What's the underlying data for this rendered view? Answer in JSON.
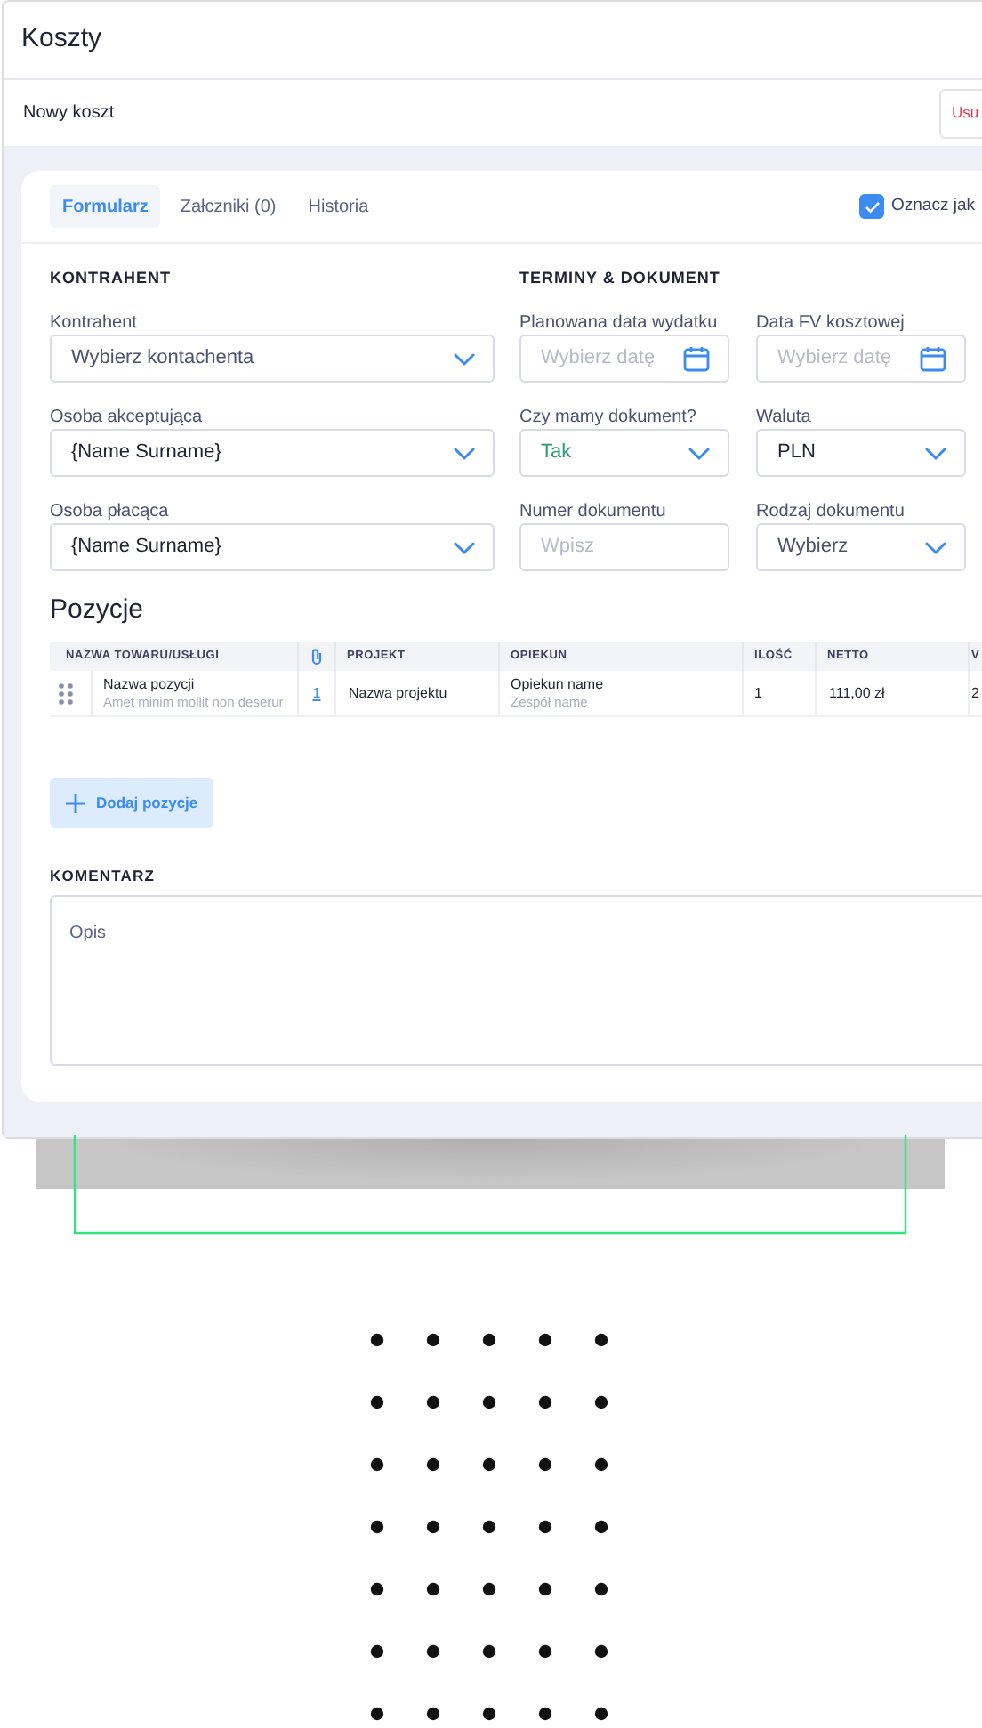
{
  "page": {
    "title": "Koszty"
  },
  "toolbar": {
    "title": "Nowy koszt",
    "delete_button": "Usu"
  },
  "tabs": [
    {
      "label": "Formularz",
      "selected": true
    },
    {
      "label": "Załczniki (0)",
      "selected": false
    },
    {
      "label": "Historia",
      "selected": false
    }
  ],
  "mark_checkbox": {
    "label": "Oznacz jak",
    "checked": true
  },
  "contractor": {
    "heading": "KONTRAHENT",
    "fields": [
      {
        "label": "Kontrahent",
        "kind": "select",
        "placeholder": "Wybierz kontachenta"
      },
      {
        "label": "Osoba akceptująca",
        "kind": "select",
        "value": "{Name Surname}"
      },
      {
        "label": "Osoba płacąca",
        "kind": "select",
        "value": "{Name Surname}"
      }
    ]
  },
  "dates": {
    "heading": "TERMINY & DOKUMENT",
    "fields": [
      {
        "label": "Planowana data wydatku",
        "kind": "date",
        "placeholder": "Wybierz datę"
      },
      {
        "label": "Data FV kosztowej",
        "kind": "date",
        "placeholder": "Wybierz datę"
      },
      {
        "label": "Czy mamy dokument?",
        "kind": "select",
        "value": "Tak",
        "color": "#22a06b"
      },
      {
        "label": "Waluta",
        "kind": "select",
        "value": "PLN"
      },
      {
        "label": "Numer dokumentu",
        "kind": "text",
        "placeholder": "Wpisz"
      },
      {
        "label": "Rodzaj dokumentu",
        "kind": "select",
        "placeholder": "Wybierz"
      }
    ]
  },
  "items": {
    "title": "Pozycje",
    "columns": [
      {
        "kind": "text",
        "label": "NAZWA TOWARU/USŁUGI"
      },
      {
        "kind": "icon"
      },
      {
        "kind": "text",
        "label": "PROJEKT"
      },
      {
        "kind": "text",
        "label": "OPIEKUN"
      },
      {
        "kind": "text",
        "label": "ILOŚĆ"
      },
      {
        "kind": "text",
        "label": "NETTO"
      },
      {
        "kind": "text",
        "label": "V"
      }
    ],
    "rows": [
      {
        "name": "Nazwa pozycji",
        "description": "Amet minim mollit non deserur",
        "attachments": "1",
        "project": "Nazwa projektu",
        "owner": "Opiekun name",
        "team": "Zespół name",
        "quantity": "1",
        "net": "111,00 zł",
        "column_7": "2"
      }
    ],
    "add_button": "Dodaj pozycje"
  },
  "comment": {
    "heading": "KOMENTARZ",
    "placeholder": "Opis"
  }
}
